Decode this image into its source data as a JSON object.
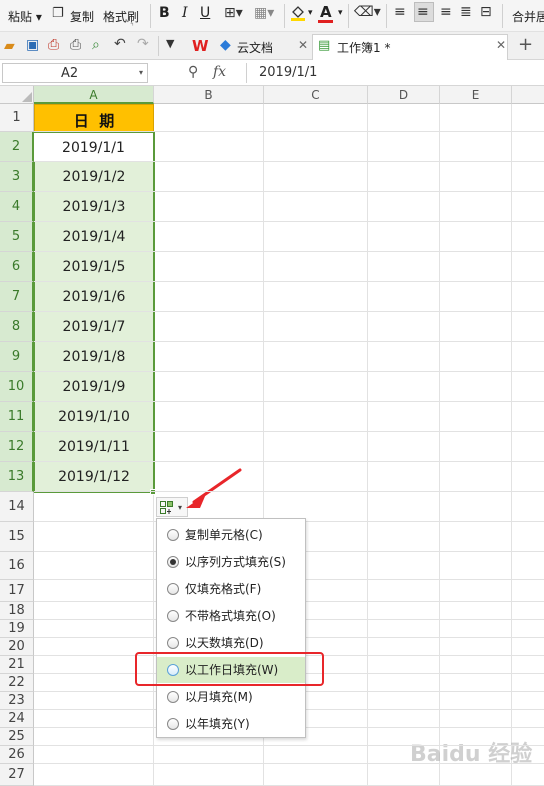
{
  "toolbar1": {
    "paste_label": "粘贴",
    "copy_label": "复制",
    "format_painter_label": "格式刷",
    "bold": "B",
    "italic": "I",
    "underline": "U",
    "font_color_letter": "A",
    "merge_label": "合并居",
    "font_color": "#e02020",
    "fill_color": "#ffd800"
  },
  "toolbar2": {
    "tabs": [
      {
        "label": "云文档"
      },
      {
        "label": "工作簿1 *"
      }
    ]
  },
  "formula_bar": {
    "name_box": "A2",
    "fx": "fx",
    "content": "2019/1/1"
  },
  "columns": [
    "A",
    "B",
    "C",
    "D",
    "E"
  ],
  "rows": [
    "1",
    "2",
    "3",
    "4",
    "5",
    "6",
    "7",
    "8",
    "9",
    "10",
    "11",
    "12",
    "13",
    "14",
    "15",
    "16",
    "17",
    "18",
    "19",
    "20",
    "21",
    "22",
    "23",
    "24",
    "25",
    "26",
    "27"
  ],
  "cells": {
    "header": "日  期",
    "dates": [
      "2019/1/1",
      "2019/1/2",
      "2019/1/3",
      "2019/1/4",
      "2019/1/5",
      "2019/1/6",
      "2019/1/7",
      "2019/1/8",
      "2019/1/9",
      "2019/1/10",
      "2019/1/11",
      "2019/1/12"
    ]
  },
  "fill_menu": {
    "items": [
      {
        "label": "复制单元格(C)",
        "selected": false
      },
      {
        "label": "以序列方式填充(S)",
        "selected": true
      },
      {
        "label": "仅填充格式(F)",
        "selected": false
      },
      {
        "label": "不带格式填充(O)",
        "selected": false
      },
      {
        "label": "以天数填充(D)",
        "selected": false
      },
      {
        "label": "以工作日填充(W)",
        "selected": false,
        "highlighted": true
      },
      {
        "label": "以月填充(M)",
        "selected": false
      },
      {
        "label": "以年填充(Y)",
        "selected": false
      }
    ]
  },
  "watermark": "Baidu 经验",
  "colors": {
    "header_fill": "#ffc000",
    "selection_fill": "#e2f0d9",
    "selection_border": "#5a9a3a",
    "annotation_red": "#e8262a",
    "menu_highlight": "#d9edc9"
  }
}
